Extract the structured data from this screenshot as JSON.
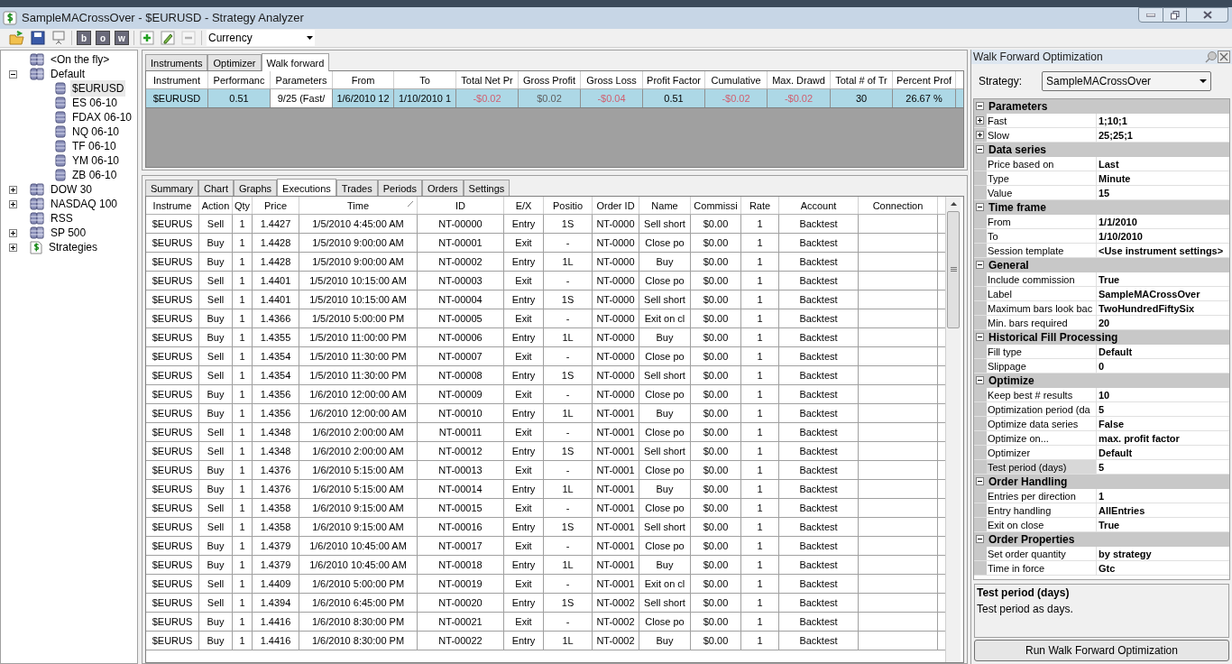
{
  "window": {
    "title": "SampleMACrossOver - $EURUSD - Strategy Analyzer"
  },
  "toolbar": {
    "letter_buttons": [
      {
        "label": "b",
        "disabled": false
      },
      {
        "label": "o",
        "disabled": false
      },
      {
        "label": "w",
        "disabled": false
      }
    ],
    "edit_buttons": [
      {
        "kind": "add",
        "disabled": false
      },
      {
        "kind": "edit",
        "disabled": false
      },
      {
        "kind": "remove",
        "disabled": true
      }
    ],
    "currency": {
      "value": "Currency"
    }
  },
  "tree": [
    {
      "label": "<On the fly>",
      "kind": "list",
      "selected": false
    },
    {
      "label": "Default",
      "kind": "list",
      "expanded": true,
      "selected": false,
      "children": [
        {
          "label": "$EURUSD",
          "kind": "instrument",
          "selected": true
        },
        {
          "label": "ES 06-10",
          "kind": "instrument",
          "selected": false
        },
        {
          "label": "FDAX 06-10",
          "kind": "instrument",
          "selected": false
        },
        {
          "label": "NQ 06-10",
          "kind": "instrument",
          "selected": false
        },
        {
          "label": "TF 06-10",
          "kind": "instrument",
          "selected": false
        },
        {
          "label": "YM 06-10",
          "kind": "instrument",
          "selected": false
        },
        {
          "label": "ZB 06-10",
          "kind": "instrument",
          "selected": false
        }
      ]
    },
    {
      "label": "DOW 30",
      "kind": "list",
      "expanded": false,
      "selected": false
    },
    {
      "label": "NASDAQ 100",
      "kind": "list",
      "expanded": false,
      "selected": false
    },
    {
      "label": "RSS",
      "kind": "list",
      "selected": false
    },
    {
      "label": "SP 500",
      "kind": "list",
      "expanded": false,
      "selected": false
    },
    {
      "label": "Strategies",
      "kind": "strategy",
      "expanded": false,
      "selected": false
    }
  ],
  "top_tabs": [
    {
      "label": "Instruments",
      "selected": false
    },
    {
      "label": "Optimizer",
      "selected": false
    },
    {
      "label": "Walk forward",
      "selected": true
    }
  ],
  "results": {
    "columns": [
      "Instrument",
      "Performanc",
      "Parameters",
      "From",
      "To",
      "Total Net Pr",
      "Gross Profit",
      "Gross Loss",
      "Profit Factor",
      "Cumulative",
      "Max. Drawd",
      "Total # of Tr",
      "Percent Prof"
    ],
    "rows": [
      {
        "selected": true,
        "cells": [
          {
            "text": "$EURUSD",
            "negative": false,
            "focused": false
          },
          {
            "text": "0.51",
            "negative": false,
            "focused": false
          },
          {
            "text": "9/25 (Fast/",
            "negative": false,
            "focused": true
          },
          {
            "text": "1/6/2010 12",
            "negative": false,
            "focused": false
          },
          {
            "text": "1/10/2010 1",
            "negative": false,
            "focused": false
          },
          {
            "text": "-$0.02",
            "negative": true,
            "focused": false
          },
          {
            "text": "$0.02",
            "negative": false,
            "focused": false
          },
          {
            "text": "-$0.04",
            "negative": true,
            "focused": false
          },
          {
            "text": "0.51",
            "negative": false,
            "focused": false
          },
          {
            "text": "-$0.02",
            "negative": true,
            "focused": false
          },
          {
            "text": "-$0.02",
            "negative": true,
            "focused": false
          },
          {
            "text": "30",
            "negative": false,
            "focused": false
          },
          {
            "text": "26.67 %",
            "negative": false,
            "focused": false
          }
        ]
      }
    ]
  },
  "bottom_tabs": [
    {
      "label": "Summary",
      "selected": false
    },
    {
      "label": "Chart",
      "selected": false
    },
    {
      "label": "Graphs",
      "selected": false
    },
    {
      "label": "Executions",
      "selected": true
    },
    {
      "label": "Trades",
      "selected": false
    },
    {
      "label": "Periods",
      "selected": false
    },
    {
      "label": "Orders",
      "selected": false
    },
    {
      "label": "Settings",
      "selected": false
    }
  ],
  "executions": {
    "columns": [
      {
        "label": "Instrume",
        "sorted": false
      },
      {
        "label": "Action",
        "sorted": false
      },
      {
        "label": "Qty",
        "sorted": false
      },
      {
        "label": "Price",
        "sorted": false
      },
      {
        "label": "Time",
        "sorted": true
      },
      {
        "label": "ID",
        "sorted": false
      },
      {
        "label": "E/X",
        "sorted": false
      },
      {
        "label": "Positio",
        "sorted": false
      },
      {
        "label": "Order ID",
        "sorted": false
      },
      {
        "label": "Name",
        "sorted": false
      },
      {
        "label": "Commissi",
        "sorted": false
      },
      {
        "label": "Rate",
        "sorted": false
      },
      {
        "label": "Account",
        "sorted": false
      },
      {
        "label": "Connection",
        "sorted": false
      }
    ],
    "rows": [
      [
        "$EURUS",
        "Sell",
        "1",
        "1.4427",
        "1/5/2010 4:45:00 AM",
        "NT-00000",
        "Entry",
        "1S",
        "NT-0000",
        "Sell short",
        "$0.00",
        "1",
        "Backtest"
      ],
      [
        "$EURUS",
        "Buy",
        "1",
        "1.4428",
        "1/5/2010 9:00:00 AM",
        "NT-00001",
        "Exit",
        "-",
        "NT-0000",
        "Close po",
        "$0.00",
        "1",
        "Backtest"
      ],
      [
        "$EURUS",
        "Buy",
        "1",
        "1.4428",
        "1/5/2010 9:00:00 AM",
        "NT-00002",
        "Entry",
        "1L",
        "NT-0000",
        "Buy",
        "$0.00",
        "1",
        "Backtest"
      ],
      [
        "$EURUS",
        "Sell",
        "1",
        "1.4401",
        "1/5/2010 10:15:00 AM",
        "NT-00003",
        "Exit",
        "-",
        "NT-0000",
        "Close po",
        "$0.00",
        "1",
        "Backtest"
      ],
      [
        "$EURUS",
        "Sell",
        "1",
        "1.4401",
        "1/5/2010 10:15:00 AM",
        "NT-00004",
        "Entry",
        "1S",
        "NT-0000",
        "Sell short",
        "$0.00",
        "1",
        "Backtest"
      ],
      [
        "$EURUS",
        "Buy",
        "1",
        "1.4366",
        "1/5/2010 5:00:00 PM",
        "NT-00005",
        "Exit",
        "-",
        "NT-0000",
        "Exit on cl",
        "$0.00",
        "1",
        "Backtest"
      ],
      [
        "$EURUS",
        "Buy",
        "1",
        "1.4355",
        "1/5/2010 11:00:00 PM",
        "NT-00006",
        "Entry",
        "1L",
        "NT-0000",
        "Buy",
        "$0.00",
        "1",
        "Backtest"
      ],
      [
        "$EURUS",
        "Sell",
        "1",
        "1.4354",
        "1/5/2010 11:30:00 PM",
        "NT-00007",
        "Exit",
        "-",
        "NT-0000",
        "Close po",
        "$0.00",
        "1",
        "Backtest"
      ],
      [
        "$EURUS",
        "Sell",
        "1",
        "1.4354",
        "1/5/2010 11:30:00 PM",
        "NT-00008",
        "Entry",
        "1S",
        "NT-0000",
        "Sell short",
        "$0.00",
        "1",
        "Backtest"
      ],
      [
        "$EURUS",
        "Buy",
        "1",
        "1.4356",
        "1/6/2010 12:00:00 AM",
        "NT-00009",
        "Exit",
        "-",
        "NT-0000",
        "Close po",
        "$0.00",
        "1",
        "Backtest"
      ],
      [
        "$EURUS",
        "Buy",
        "1",
        "1.4356",
        "1/6/2010 12:00:00 AM",
        "NT-00010",
        "Entry",
        "1L",
        "NT-0001",
        "Buy",
        "$0.00",
        "1",
        "Backtest"
      ],
      [
        "$EURUS",
        "Sell",
        "1",
        "1.4348",
        "1/6/2010 2:00:00 AM",
        "NT-00011",
        "Exit",
        "-",
        "NT-0001",
        "Close po",
        "$0.00",
        "1",
        "Backtest"
      ],
      [
        "$EURUS",
        "Sell",
        "1",
        "1.4348",
        "1/6/2010 2:00:00 AM",
        "NT-00012",
        "Entry",
        "1S",
        "NT-0001",
        "Sell short",
        "$0.00",
        "1",
        "Backtest"
      ],
      [
        "$EURUS",
        "Buy",
        "1",
        "1.4376",
        "1/6/2010 5:15:00 AM",
        "NT-00013",
        "Exit",
        "-",
        "NT-0001",
        "Close po",
        "$0.00",
        "1",
        "Backtest"
      ],
      [
        "$EURUS",
        "Buy",
        "1",
        "1.4376",
        "1/6/2010 5:15:00 AM",
        "NT-00014",
        "Entry",
        "1L",
        "NT-0001",
        "Buy",
        "$0.00",
        "1",
        "Backtest"
      ],
      [
        "$EURUS",
        "Sell",
        "1",
        "1.4358",
        "1/6/2010 9:15:00 AM",
        "NT-00015",
        "Exit",
        "-",
        "NT-0001",
        "Close po",
        "$0.00",
        "1",
        "Backtest"
      ],
      [
        "$EURUS",
        "Sell",
        "1",
        "1.4358",
        "1/6/2010 9:15:00 AM",
        "NT-00016",
        "Entry",
        "1S",
        "NT-0001",
        "Sell short",
        "$0.00",
        "1",
        "Backtest"
      ],
      [
        "$EURUS",
        "Buy",
        "1",
        "1.4379",
        "1/6/2010 10:45:00 AM",
        "NT-00017",
        "Exit",
        "-",
        "NT-0001",
        "Close po",
        "$0.00",
        "1",
        "Backtest"
      ],
      [
        "$EURUS",
        "Buy",
        "1",
        "1.4379",
        "1/6/2010 10:45:00 AM",
        "NT-00018",
        "Entry",
        "1L",
        "NT-0001",
        "Buy",
        "$0.00",
        "1",
        "Backtest"
      ],
      [
        "$EURUS",
        "Sell",
        "1",
        "1.4409",
        "1/6/2010 5:00:00 PM",
        "NT-00019",
        "Exit",
        "-",
        "NT-0001",
        "Exit on cl",
        "$0.00",
        "1",
        "Backtest"
      ],
      [
        "$EURUS",
        "Sell",
        "1",
        "1.4394",
        "1/6/2010 6:45:00 PM",
        "NT-00020",
        "Entry",
        "1S",
        "NT-0002",
        "Sell short",
        "$0.00",
        "1",
        "Backtest"
      ],
      [
        "$EURUS",
        "Buy",
        "1",
        "1.4416",
        "1/6/2010 8:30:00 PM",
        "NT-00021",
        "Exit",
        "-",
        "NT-0002",
        "Close po",
        "$0.00",
        "1",
        "Backtest"
      ],
      [
        "$EURUS",
        "Buy",
        "1",
        "1.4416",
        "1/6/2010 8:30:00 PM",
        "NT-00022",
        "Entry",
        "1L",
        "NT-0002",
        "Buy",
        "$0.00",
        "1",
        "Backtest"
      ]
    ]
  },
  "panel": {
    "title": "Walk Forward Optimization",
    "strategy_label": "Strategy:",
    "strategy_value": "SampleMACrossOver",
    "categories": [
      {
        "name": "Parameters",
        "expanded": true,
        "items": [
          {
            "name": "Fast",
            "value": "1;10;1",
            "expandable": true,
            "expanded": false,
            "selected": false
          },
          {
            "name": "Slow",
            "value": "25;25;1",
            "expandable": true,
            "expanded": false,
            "selected": false
          }
        ]
      },
      {
        "name": "Data series",
        "expanded": true,
        "items": [
          {
            "name": "Price based on",
            "value": "Last",
            "expandable": false,
            "selected": false
          },
          {
            "name": "Type",
            "value": "Minute",
            "expandable": false,
            "selected": false
          },
          {
            "name": "Value",
            "value": "15",
            "expandable": false,
            "selected": false
          }
        ]
      },
      {
        "name": "Time frame",
        "expanded": true,
        "items": [
          {
            "name": "From",
            "value": "1/1/2010",
            "expandable": false,
            "selected": false
          },
          {
            "name": "To",
            "value": "1/10/2010",
            "expandable": false,
            "selected": false
          },
          {
            "name": "Session template",
            "value": "<Use instrument settings>",
            "expandable": false,
            "selected": false
          }
        ]
      },
      {
        "name": "General",
        "expanded": true,
        "items": [
          {
            "name": "Include commission",
            "value": "True",
            "expandable": false,
            "selected": false
          },
          {
            "name": "Label",
            "value": "SampleMACrossOver",
            "expandable": false,
            "selected": false
          },
          {
            "name": "Maximum bars look bac",
            "value": "TwoHundredFiftySix",
            "expandable": false,
            "selected": false
          },
          {
            "name": "Min. bars required",
            "value": "20",
            "expandable": false,
            "selected": false
          }
        ]
      },
      {
        "name": "Historical Fill Processing",
        "expanded": true,
        "items": [
          {
            "name": "Fill type",
            "value": "Default",
            "expandable": false,
            "selected": false
          },
          {
            "name": "Slippage",
            "value": "0",
            "expandable": false,
            "selected": false
          }
        ]
      },
      {
        "name": "Optimize",
        "expanded": true,
        "items": [
          {
            "name": "Keep best # results",
            "value": "10",
            "expandable": false,
            "selected": false
          },
          {
            "name": "Optimization period (da",
            "value": "5",
            "expandable": false,
            "selected": false
          },
          {
            "name": "Optimize data series",
            "value": "False",
            "expandable": false,
            "selected": false
          },
          {
            "name": "Optimize on...",
            "value": "max. profit factor",
            "expandable": false,
            "selected": false
          },
          {
            "name": "Optimizer",
            "value": "Default",
            "expandable": false,
            "selected": false
          },
          {
            "name": "Test period (days)",
            "value": "5",
            "expandable": false,
            "selected": true
          }
        ]
      },
      {
        "name": "Order Handling",
        "expanded": true,
        "items": [
          {
            "name": "Entries per direction",
            "value": "1",
            "expandable": false,
            "selected": false
          },
          {
            "name": "Entry handling",
            "value": "AllEntries",
            "expandable": false,
            "selected": false
          },
          {
            "name": "Exit on close",
            "value": "True",
            "expandable": false,
            "selected": false
          }
        ]
      },
      {
        "name": "Order Properties",
        "expanded": true,
        "items": [
          {
            "name": "Set order quantity",
            "value": "by strategy",
            "expandable": false,
            "selected": false
          },
          {
            "name": "Time in force",
            "value": "Gtc",
            "expandable": false,
            "selected": false
          }
        ]
      }
    ],
    "help_title": "Test period (days)",
    "help_text": "Test period as days.",
    "run_button": "Run Walk Forward Optimization"
  }
}
